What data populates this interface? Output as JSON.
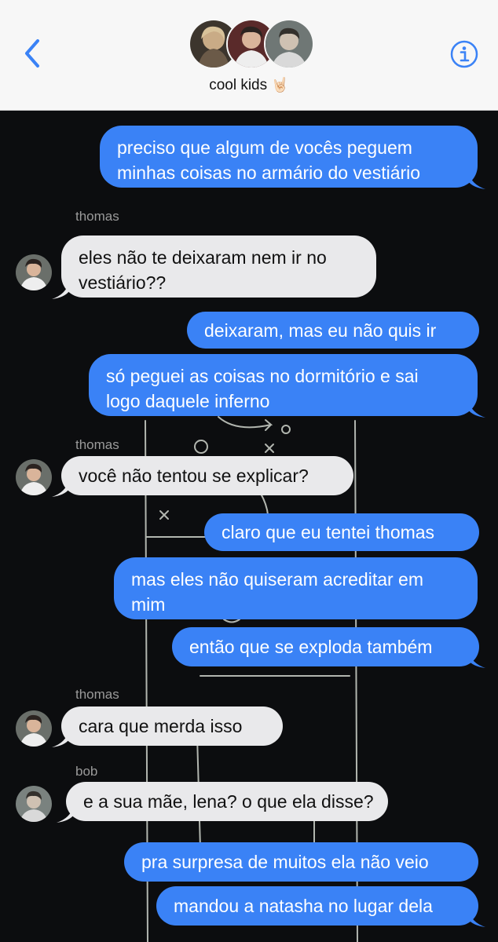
{
  "header": {
    "group_name": "cool kids",
    "group_emoji": "🤘🏻",
    "icons": [
      "back-chevron-icon",
      "info-icon"
    ],
    "colors": {
      "accent": "#3a82f6",
      "header_bg": "#f7f7f7"
    }
  },
  "conversation": {
    "colors": {
      "outgoing": "#3a82f6",
      "incoming": "#e9e9eb",
      "background": "#0c0d0f"
    },
    "messages": [
      {
        "from": "me",
        "lines": [
          "preciso que algum de vocês peguem",
          "minhas coisas no armário do vestiário"
        ]
      },
      {
        "from": "thomas",
        "sender_label": "thomas",
        "lines": [
          "eles não te deixaram nem ir no",
          "vestiário??"
        ]
      },
      {
        "from": "me",
        "lines": [
          "deixaram, mas eu não quis ir"
        ]
      },
      {
        "from": "me",
        "lines": [
          "só peguei as coisas no dormitório e sai",
          "logo daquele inferno"
        ]
      },
      {
        "from": "thomas",
        "sender_label": "thomas",
        "lines": [
          "você não tentou se explicar?"
        ]
      },
      {
        "from": "me",
        "lines": [
          "claro que eu tentei thomas"
        ]
      },
      {
        "from": "me",
        "lines": [
          "mas eles não quiseram acreditar em",
          "mim"
        ]
      },
      {
        "from": "me",
        "lines": [
          "então que se exploda também"
        ]
      },
      {
        "from": "thomas",
        "sender_label": "thomas",
        "lines": [
          "cara que merda isso"
        ]
      },
      {
        "from": "bob",
        "sender_label": "bob",
        "lines": [
          "e a sua mãe, lena? o que ela disse?"
        ]
      },
      {
        "from": "me",
        "lines": [
          "pra surpresa de muitos ela não veio"
        ]
      },
      {
        "from": "me",
        "lines": [
          "mandou a natasha no lugar dela"
        ]
      }
    ]
  }
}
